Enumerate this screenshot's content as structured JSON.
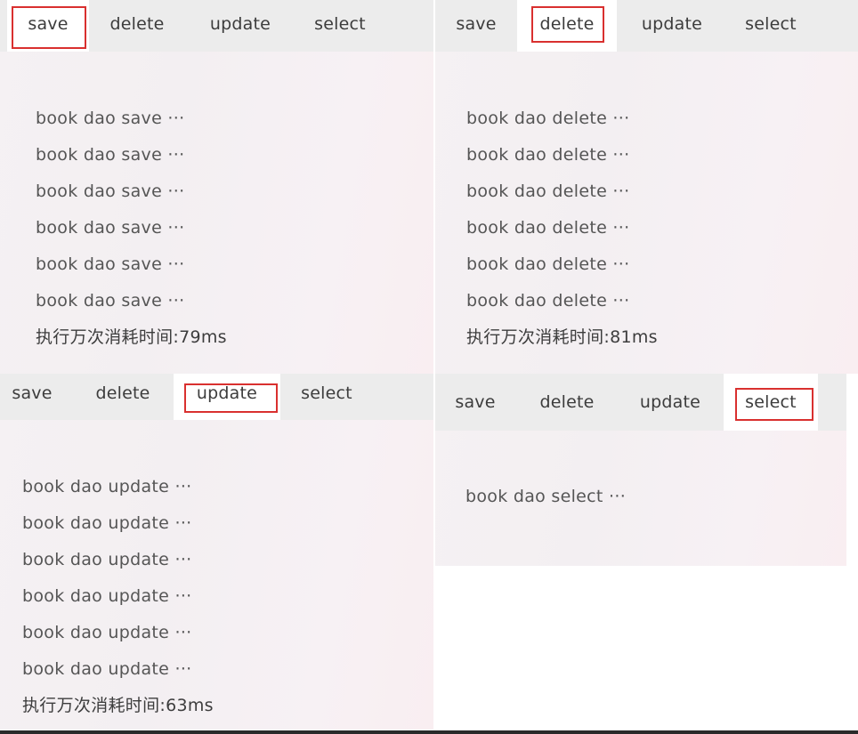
{
  "tabs": [
    "save",
    "delete",
    "update",
    "select"
  ],
  "panels": [
    {
      "active_tab": "save",
      "lines": [
        "book dao save ···",
        "book dao save ···",
        "book dao save ···",
        "book dao save ···",
        "book dao save ···",
        "book dao save ···"
      ],
      "result": "执行万次消耗时间:79ms"
    },
    {
      "active_tab": "delete",
      "lines": [
        "book dao delete ···",
        "book dao delete ···",
        "book dao delete ···",
        "book dao delete ···",
        "book dao delete ···",
        "book dao delete ···"
      ],
      "result": "执行万次消耗时间:81ms"
    },
    {
      "active_tab": "update",
      "lines": [
        "book dao update ···",
        "book dao update ···",
        "book dao update ···",
        "book dao update ···",
        "book dao update ···",
        "book dao update ···"
      ],
      "result": "执行万次消耗时间:63ms"
    },
    {
      "active_tab": "select",
      "lines": [
        "book dao select ···"
      ]
    }
  ],
  "colors": {
    "highlight": "#d9302f",
    "tabbar": "#ececec",
    "active_tab": "#ffffff"
  }
}
